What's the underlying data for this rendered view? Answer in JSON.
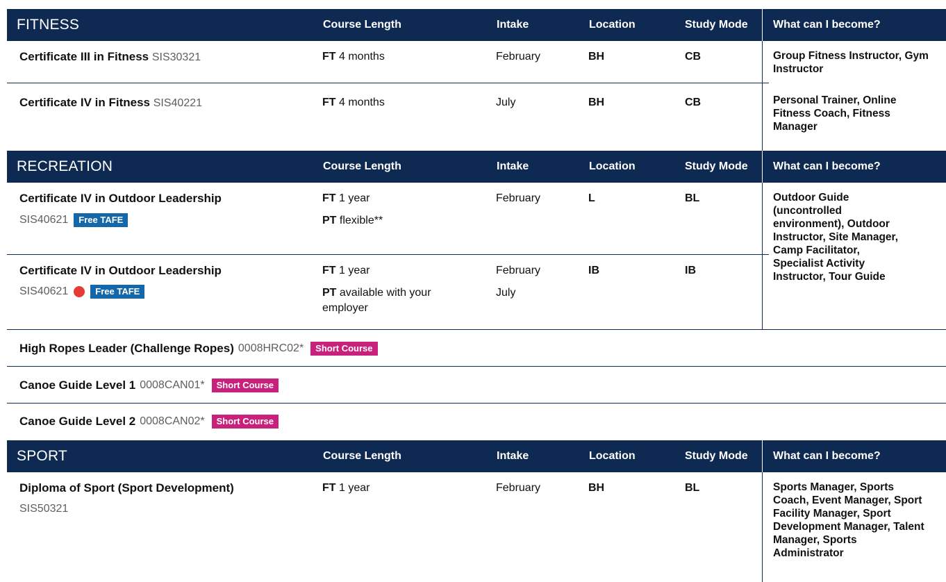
{
  "headers": {
    "course_length": "Course Length",
    "intake": "Intake",
    "location": "Location",
    "study_mode": "Study Mode",
    "careers": "What can I become?"
  },
  "fitness": {
    "title": "FITNESS",
    "rows": [
      {
        "name": "Certificate III in Fitness",
        "code": "SIS30321",
        "length_type": "FT",
        "length": "4 months",
        "intake": "February",
        "location": "BH",
        "mode": "CB",
        "careers": "Group Fitness Instructor, Gym Instructor"
      },
      {
        "name": "Certificate IV in Fitness",
        "code": "SIS40221",
        "length_type": "FT",
        "length": "4 months",
        "intake": "July",
        "location": "BH",
        "mode": "CB",
        "careers": "Personal Trainer, Online Fitness Coach, Fitness Manager"
      }
    ]
  },
  "recreation": {
    "title": "RECREATION",
    "rows": [
      {
        "name": "Certificate IV in Outdoor Leadership",
        "code": "SIS40621",
        "badge": "Free TAFE",
        "length_type": "FT",
        "length": "1 year",
        "length_type2": "PT",
        "length2": "flexible**",
        "intake": "February",
        "location": "L",
        "mode": "BL"
      },
      {
        "name": "Certificate IV in Outdoor Leadership",
        "code": "SIS40621",
        "badge": "Free TAFE",
        "length_type": "FT",
        "length": "1 year",
        "length_type2": "PT",
        "length2": "available with your employer",
        "intake": "February",
        "intake2": "July",
        "location": "IB",
        "mode": "IB"
      }
    ],
    "careers": "Outdoor Guide (uncontrolled environment), Outdoor Instructor, Site Manager, Camp Facilitator, Specialist Activity Instructor, Tour Guide",
    "short_courses": [
      {
        "name": "High Ropes Leader (Challenge Ropes)",
        "code": "0008HRC02*",
        "badge": "Short Course"
      },
      {
        "name": "Canoe Guide Level 1",
        "code": "0008CAN01*",
        "badge": "Short Course"
      },
      {
        "name": "Canoe Guide Level 2",
        "code": "0008CAN02*",
        "badge": "Short Course"
      }
    ]
  },
  "sport": {
    "title": "SPORT",
    "rows": [
      {
        "name": "Diploma of Sport (Sport Development)",
        "code": "SIS50321",
        "length_type": "FT",
        "length": "1 year",
        "intake": "February",
        "location": "BH",
        "mode": "BL",
        "careers": "Sports Manager, Sports Coach, Event Manager, Sport Facility Manager, Sport Development Manager, Talent Manager, Sports Administrator"
      }
    ]
  },
  "colors": {
    "header_bg": "#0f2a52",
    "free_tafe": "#1467a8",
    "short_course": "#c8207b",
    "dot": "#e53935"
  }
}
